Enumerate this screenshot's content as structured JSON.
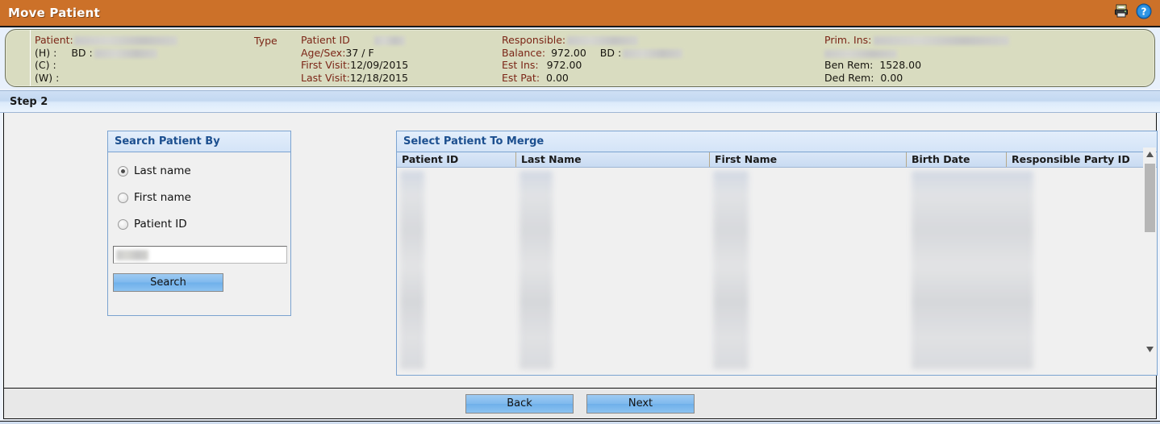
{
  "titlebar": {
    "title": "Move Patient",
    "icons": [
      {
        "name": "printer-icon"
      },
      {
        "name": "help-icon"
      }
    ]
  },
  "patient_info": {
    "patient": {
      "label": "Patient:",
      "value_redacted": true,
      "phones": [
        {
          "label": "(H) :",
          "extra_label": "BD :",
          "value_redacted": true
        },
        {
          "label": "(C) :",
          "value_redacted": true
        },
        {
          "label": "(W) :",
          "value_redacted": true
        }
      ]
    },
    "type_label": "Type",
    "identity": {
      "patient_id_label": "Patient ID",
      "patient_id_value_redacted": true,
      "rows": [
        {
          "label": "Age/Sex:",
          "value": "37 / F"
        },
        {
          "label": "First Visit:",
          "value": "12/09/2015"
        },
        {
          "label": "Last Visit:",
          "value": "12/18/2015"
        }
      ]
    },
    "responsible": {
      "label": "Responsible:",
      "value_redacted": true,
      "rows": [
        {
          "label": "Balance:",
          "value": "972.00",
          "extra_label": "BD :",
          "extra_redacted": true
        },
        {
          "label": "Est Ins:",
          "value": "972.00"
        },
        {
          "label": "Est Pat:",
          "value": "0.00"
        }
      ]
    },
    "primary_insurance": {
      "label": "Prim. Ins:",
      "value_redacted": true,
      "value_line2_redacted": true,
      "rows": [
        {
          "label": "Ben Rem:",
          "value": "1528.00"
        },
        {
          "label": "Ded Rem:",
          "value": "0.00"
        }
      ]
    }
  },
  "step": {
    "label": "Step 2"
  },
  "search_panel": {
    "title": "Search Patient By",
    "options": [
      {
        "label": "Last name",
        "selected": true
      },
      {
        "label": "First name",
        "selected": false
      },
      {
        "label": "Patient ID",
        "selected": false
      }
    ],
    "input": {
      "value_redacted": true,
      "placeholder": ""
    },
    "search_button": "Search"
  },
  "merge_panel": {
    "title": "Select Patient To Merge",
    "columns": [
      "Patient ID",
      "Last Name",
      "First Name",
      "Birth Date",
      "Responsible Party ID"
    ],
    "rows_redacted": true,
    "scrollbar": {
      "up_arrow": "▲",
      "down_arrow": "▼",
      "thumb_position": "top"
    }
  },
  "footer": {
    "back_button": "Back",
    "next_button": "Next"
  },
  "colors": {
    "title_bar": "#cc7129",
    "info_panel": "#d9dcc0",
    "info_label": "#7b2516",
    "panel_header_text": "#1c4f8f",
    "button_blue": "#7fb9ee",
    "step_bar": "#c3d8f1"
  }
}
